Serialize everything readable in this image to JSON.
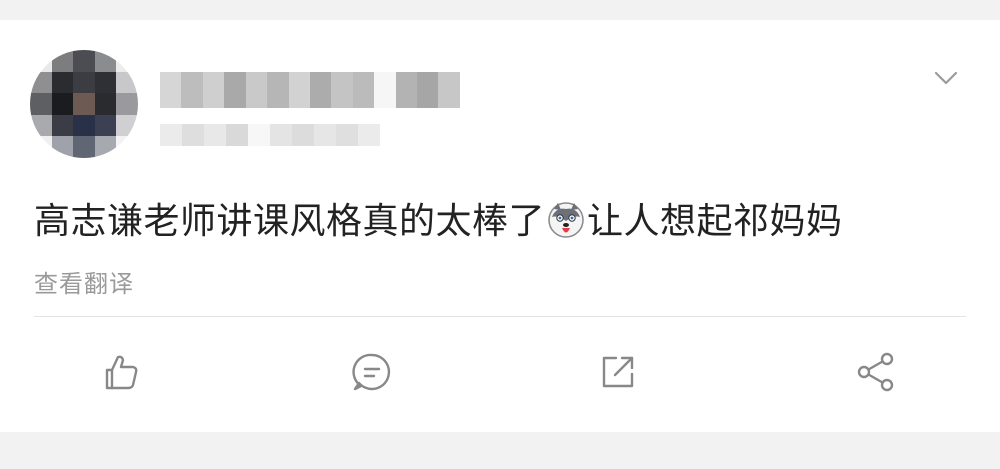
{
  "post": {
    "text_before_emoji": "高志谦老师讲课风格真的太棒了",
    "emoji": "husky-face-emoji",
    "text_after_emoji": "让人想起祁妈妈",
    "translate_label": "查看翻译"
  },
  "header": {
    "avatar": "blurred-avatar",
    "username": "",
    "meta": "",
    "menu_icon": "chevron-down-icon"
  },
  "actions": [
    {
      "icon": "thumbs-up-icon"
    },
    {
      "icon": "comment-icon"
    },
    {
      "icon": "repost-icon"
    },
    {
      "icon": "share-icon"
    }
  ],
  "colors": {
    "background": "#f2f2f2",
    "card": "#ffffff",
    "text": "#222222",
    "secondary_text": "#9a9a9a",
    "icon": "#888888",
    "divider": "#e3e3e3"
  }
}
